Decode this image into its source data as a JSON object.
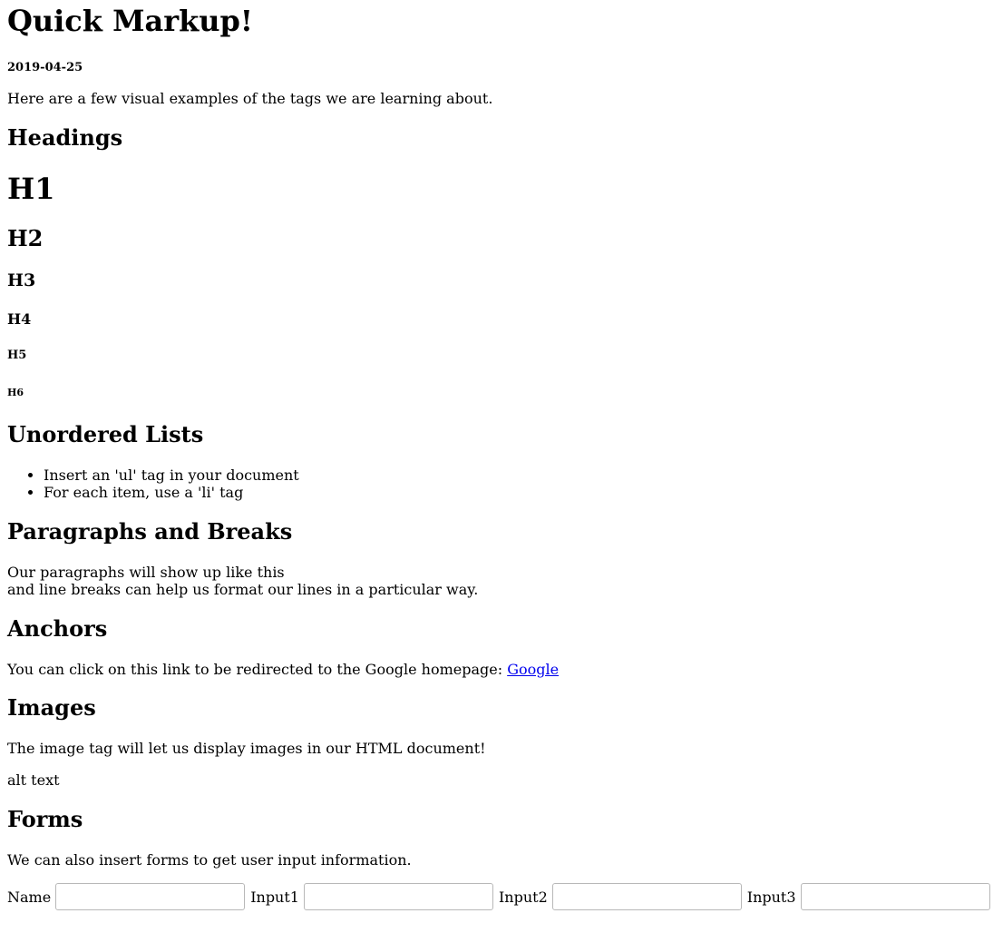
{
  "page": {
    "title": "Quick Markup!",
    "date": "2019-04-25",
    "intro": "Here are a few visual examples of the tags we are learning about."
  },
  "headings": {
    "section_title": "Headings",
    "examples": [
      "H1",
      "H2",
      "H3",
      "H4",
      "H5",
      "H6"
    ]
  },
  "lists": {
    "section_title": "Unordered Lists",
    "items": [
      "Insert an 'ul' tag in your document",
      "For each item, use a 'li' tag"
    ]
  },
  "paragraphs": {
    "section_title": "Paragraphs and Breaks",
    "line1": "Our paragraphs will show up like this",
    "line2": "and line breaks can help us format our lines in a particular way."
  },
  "anchors": {
    "section_title": "Anchors",
    "text": "You can click on this link to be redirected to the Google homepage: ",
    "link_label": "Google"
  },
  "images": {
    "section_title": "Images",
    "text": "The image tag will let us display images in our HTML document!",
    "alt_text": "alt text"
  },
  "forms": {
    "section_title": "Forms",
    "text": "We can also insert forms to get user input information.",
    "fields": [
      {
        "label": "Name",
        "value": "",
        "placeholder": ""
      },
      {
        "label": "Input1",
        "value": "",
        "placeholder": ""
      },
      {
        "label": "Input2",
        "value": "",
        "placeholder": ""
      },
      {
        "label": "Input3",
        "value": "",
        "placeholder": ""
      }
    ]
  }
}
